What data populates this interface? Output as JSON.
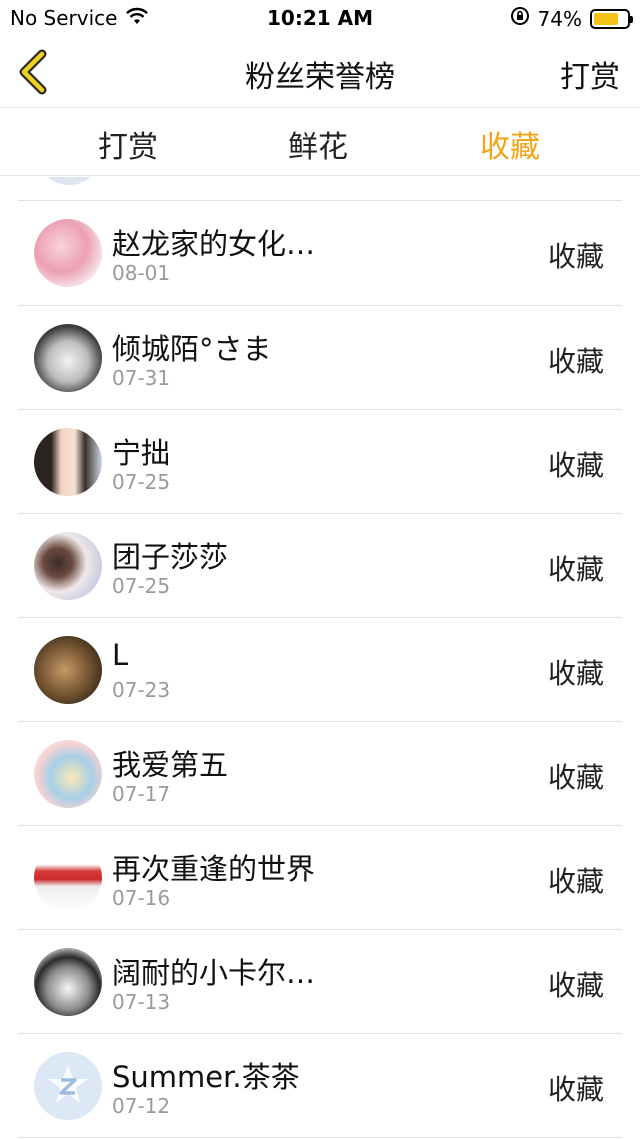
{
  "status_bar": {
    "carrier": "No Service",
    "time": "10:21 AM",
    "battery_percent": "74%",
    "battery_level": 0.74,
    "battery_color": "#f3c318"
  },
  "nav": {
    "back_icon": "chevron-left-icon",
    "title": "粉丝荣誉榜",
    "right_label": "打赏",
    "accent_color": "#f0a51a"
  },
  "tabs": [
    {
      "label": "打赏",
      "active": false
    },
    {
      "label": "鲜花",
      "active": false
    },
    {
      "label": "收藏",
      "active": true
    }
  ],
  "list": {
    "action_label": "收藏",
    "items": [
      {
        "name": "赵龙家的女化…",
        "date": "08-01",
        "action": "收藏"
      },
      {
        "name": "倾城陌°さま",
        "date": "07-31",
        "action": "收藏"
      },
      {
        "name": "宁拙",
        "date": "07-25",
        "action": "收藏"
      },
      {
        "name": "团子莎莎",
        "date": "07-25",
        "action": "收藏"
      },
      {
        "name": "L",
        "date": "07-23",
        "action": "收藏"
      },
      {
        "name": "我爱第五",
        "date": "07-17",
        "action": "收藏"
      },
      {
        "name": "再次重逢的世界",
        "date": "07-16",
        "action": "收藏"
      },
      {
        "name": "阔耐的小卡尔…",
        "date": "07-13",
        "action": "收藏"
      },
      {
        "name": "Summer.茶茶",
        "date": "07-12",
        "action": "收藏"
      }
    ]
  }
}
